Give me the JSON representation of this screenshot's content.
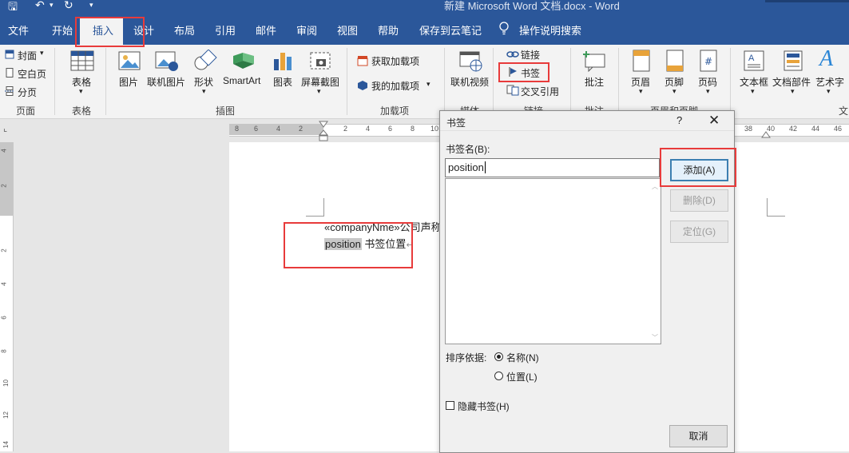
{
  "title_bar": {
    "text": "新建 Microsoft Word 文档.docx  -  Word"
  },
  "tabs": [
    "文件",
    "开始",
    "插入",
    "设计",
    "布局",
    "引用",
    "邮件",
    "审阅",
    "视图",
    "帮助",
    "保存到云笔记",
    "操作说明搜索"
  ],
  "ribbon": {
    "pages": {
      "cover": "封面",
      "blank": "空白页",
      "break": "分页",
      "group": "页面"
    },
    "tables": {
      "table": "表格",
      "group": "表格"
    },
    "illustrations": {
      "picture": "图片",
      "online_picture": "联机图片",
      "shapes": "形状",
      "smartart": "SmartArt",
      "chart": "图表",
      "screenshot": "屏幕截图",
      "group": "插图"
    },
    "addins": {
      "get": "获取加载项",
      "mine": "我的加载项",
      "group": "加载项"
    },
    "media": {
      "online_video": "联机视频",
      "group": "媒体"
    },
    "links": {
      "link": "链接",
      "bookmark": "书签",
      "cross_ref": "交叉引用",
      "group": "链接"
    },
    "comments": {
      "comment": "批注",
      "group": "批注"
    },
    "header_footer": {
      "header": "页眉",
      "footer": "页脚",
      "page_number": "页码",
      "group": "页眉和页脚"
    },
    "text": {
      "textbox": "文本框",
      "quick_parts": "文档部件",
      "wordart": "艺术字",
      "group": "文"
    }
  },
  "ruler": {
    "left_numbers": [
      "8",
      "6",
      "4",
      "2"
    ],
    "right_numbers": [
      "2",
      "4",
      "6",
      "8",
      "10"
    ],
    "far_numbers": [
      "38",
      "40",
      "42",
      "44",
      "46"
    ],
    "v_numbers": [
      "4",
      "2",
      "2",
      "4",
      "6",
      "8",
      "10",
      "12",
      "14"
    ]
  },
  "document": {
    "line1": "«companyNme»公司声",
    "line1_tail": "称",
    "highlight": "position",
    "line2_rest": " 书签位置",
    "para_mark": "↵"
  },
  "dialog": {
    "title": "书签",
    "help": "?",
    "close": "✕",
    "name_label": "书签名(B):",
    "name_value": "position",
    "add": "添加(A)",
    "delete": "删除(D)",
    "goto": "定位(G)",
    "sort_label": "排序依据:",
    "sort_name": "名称(N)",
    "sort_location": "位置(L)",
    "hidden": "隐藏书签(H)",
    "cancel": "取消"
  },
  "colors": {
    "brand": "#2b579a",
    "annotation": "#e83b3b"
  }
}
